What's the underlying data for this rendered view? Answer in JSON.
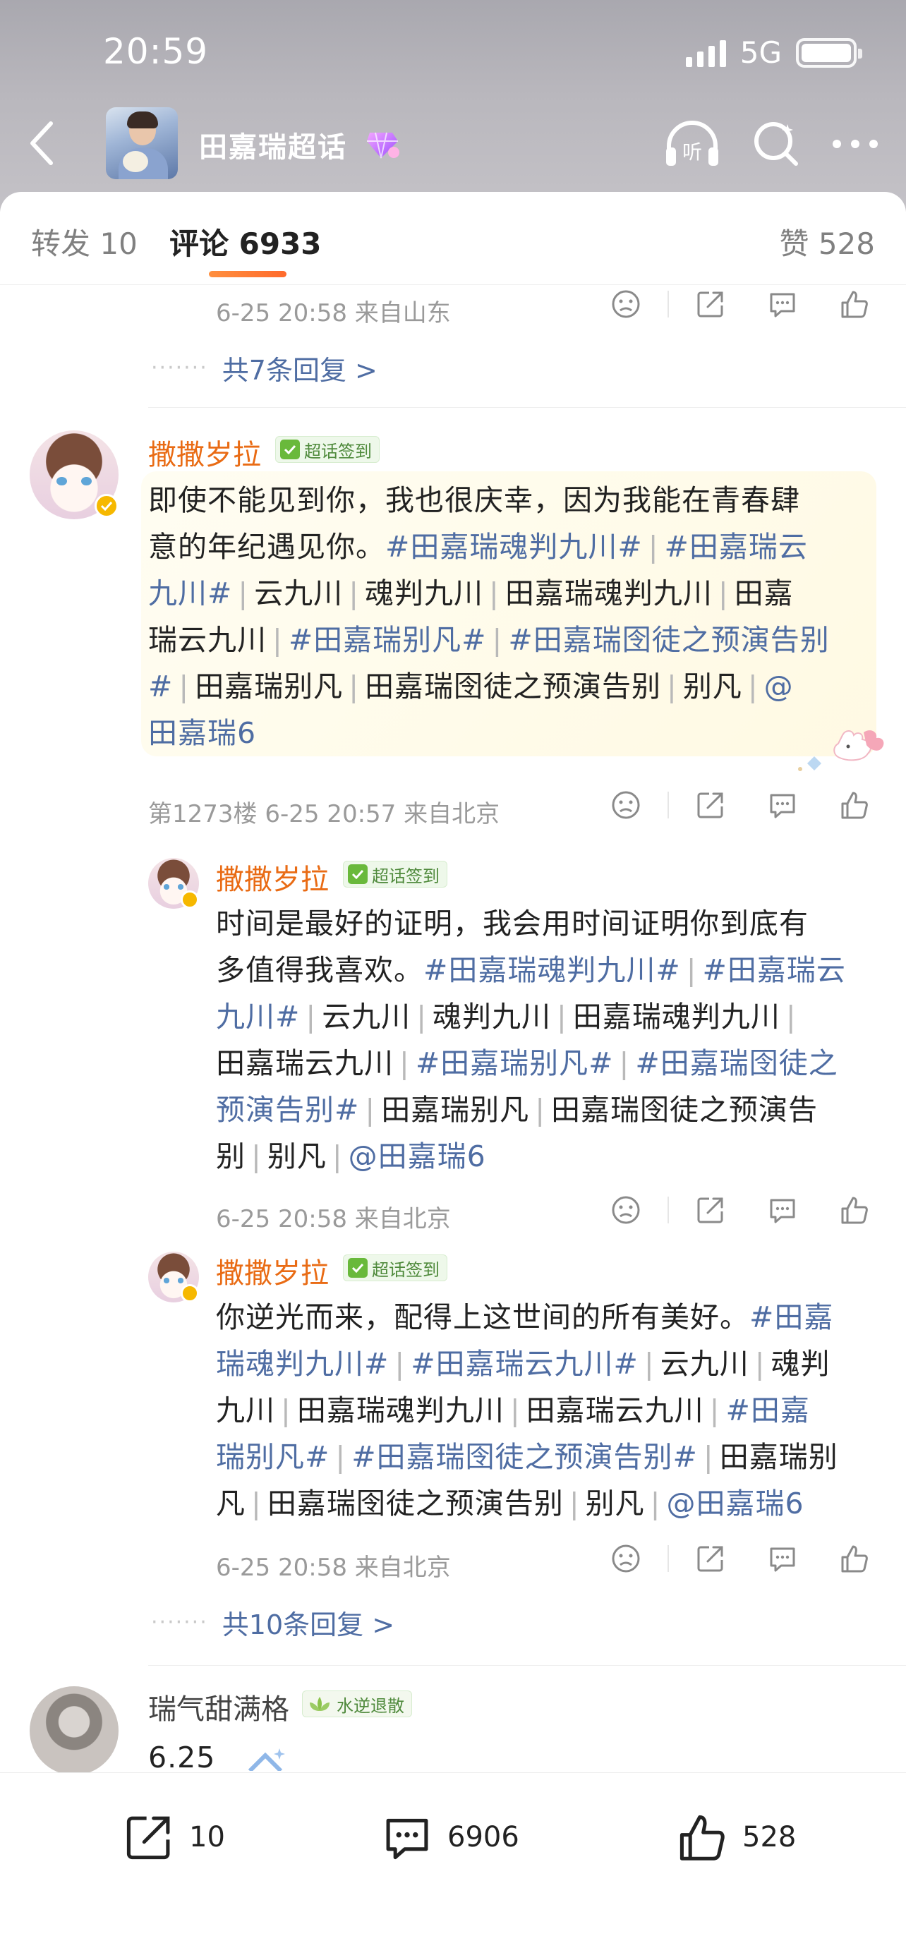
{
  "status": {
    "time": "20:59",
    "network": "5G"
  },
  "header": {
    "title": "田嘉瑞超话"
  },
  "tabs": {
    "repost": "转发 10",
    "comments": "评论 6933",
    "likes": "赞 528"
  },
  "top_partial": {
    "meta": "6-25 20:58  来自山东",
    "more_replies": "共7条回复 >"
  },
  "comment1": {
    "author": "撒撒岁拉",
    "badge": "超话签到",
    "lines": [
      [
        {
          "t": "即使不能见到你，我也很庆幸，因为我能在青春肆"
        }
      ],
      [
        {
          "t": "意的年纪遇见你。"
        },
        {
          "t": "#田嘉瑞魂判九川#",
          "link": true
        },
        {
          "t": "|",
          "sep": true
        },
        {
          "t": "#田嘉瑞云",
          "link": true
        }
      ],
      [
        {
          "t": "九川#",
          "link": true
        },
        {
          "t": "|",
          "sep": true
        },
        {
          "t": "云九川"
        },
        {
          "t": "|",
          "sep": true
        },
        {
          "t": "魂判九川"
        },
        {
          "t": "|",
          "sep": true
        },
        {
          "t": "田嘉瑞魂判九川"
        },
        {
          "t": "|",
          "sep": true
        },
        {
          "t": "田嘉"
        }
      ],
      [
        {
          "t": "瑞云九川"
        },
        {
          "t": "|",
          "sep": true
        },
        {
          "t": "#田嘉瑞别凡#",
          "link": true
        },
        {
          "t": "|",
          "sep": true
        },
        {
          "t": "#田嘉瑞囹徒之预演告别",
          "link": true
        }
      ],
      [
        {
          "t": "#",
          "link": true
        },
        {
          "t": "|",
          "sep": true
        },
        {
          "t": "田嘉瑞别凡"
        },
        {
          "t": "|",
          "sep": true
        },
        {
          "t": "田嘉瑞囹徒之预演告别"
        },
        {
          "t": "|",
          "sep": true
        },
        {
          "t": "别凡"
        },
        {
          "t": "|",
          "sep": true
        },
        {
          "t": "@",
          "link": true
        }
      ],
      [
        {
          "t": "田嘉瑞6",
          "link": true
        }
      ]
    ],
    "meta": "第1273楼  6-25 20:57  来自北京"
  },
  "reply1": {
    "author": "撒撒岁拉",
    "badge": "超话签到",
    "lines": [
      [
        {
          "t": "时间是最好的证明，我会用时间证明你到底有"
        }
      ],
      [
        {
          "t": "多值得我喜欢。"
        },
        {
          "t": "#田嘉瑞魂判九川#",
          "link": true
        },
        {
          "t": "|",
          "sep": true
        },
        {
          "t": "#田嘉瑞云",
          "link": true
        }
      ],
      [
        {
          "t": "九川#",
          "link": true
        },
        {
          "t": "|",
          "sep": true
        },
        {
          "t": "云九川"
        },
        {
          "t": "|",
          "sep": true
        },
        {
          "t": "魂判九川"
        },
        {
          "t": "|",
          "sep": true
        },
        {
          "t": "田嘉瑞魂判九川"
        },
        {
          "t": "|",
          "sep": true
        }
      ],
      [
        {
          "t": "田嘉瑞云九川"
        },
        {
          "t": "|",
          "sep": true
        },
        {
          "t": "#田嘉瑞别凡#",
          "link": true
        },
        {
          "t": "|",
          "sep": true
        },
        {
          "t": "#田嘉瑞囹徒之",
          "link": true
        }
      ],
      [
        {
          "t": "预演告别#",
          "link": true
        },
        {
          "t": "|",
          "sep": true
        },
        {
          "t": "田嘉瑞别凡"
        },
        {
          "t": "|",
          "sep": true
        },
        {
          "t": "田嘉瑞囹徒之预演告"
        }
      ],
      [
        {
          "t": "别"
        },
        {
          "t": "|",
          "sep": true
        },
        {
          "t": "别凡"
        },
        {
          "t": "|",
          "sep": true
        },
        {
          "t": "@田嘉瑞6",
          "link": true
        }
      ]
    ],
    "meta": "6-25 20:58  来自北京"
  },
  "reply2": {
    "author": "撒撒岁拉",
    "badge": "超话签到",
    "lines": [
      [
        {
          "t": "你逆光而来，配得上这世间的所有美好。"
        },
        {
          "t": "#田嘉",
          "link": true
        }
      ],
      [
        {
          "t": "瑞魂判九川#",
          "link": true
        },
        {
          "t": "|",
          "sep": true
        },
        {
          "t": "#田嘉瑞云九川#",
          "link": true
        },
        {
          "t": "|",
          "sep": true
        },
        {
          "t": "云九川"
        },
        {
          "t": "|",
          "sep": true
        },
        {
          "t": "魂判"
        }
      ],
      [
        {
          "t": "九川"
        },
        {
          "t": "|",
          "sep": true
        },
        {
          "t": "田嘉瑞魂判九川"
        },
        {
          "t": "|",
          "sep": true
        },
        {
          "t": "田嘉瑞云九川"
        },
        {
          "t": "|",
          "sep": true
        },
        {
          "t": "#田嘉",
          "link": true
        }
      ],
      [
        {
          "t": "瑞别凡#",
          "link": true
        },
        {
          "t": "|",
          "sep": true
        },
        {
          "t": "#田嘉瑞囹徒之预演告别#",
          "link": true
        },
        {
          "t": "|",
          "sep": true
        },
        {
          "t": "田嘉瑞别"
        }
      ],
      [
        {
          "t": "凡"
        },
        {
          "t": "|",
          "sep": true
        },
        {
          "t": "田嘉瑞囹徒之预演告别"
        },
        {
          "t": "|",
          "sep": true
        },
        {
          "t": "别凡"
        },
        {
          "t": "|",
          "sep": true
        },
        {
          "t": "@田嘉瑞6",
          "link": true
        }
      ]
    ],
    "meta": "6-25 20:58  来自北京"
  },
  "replies_more": "共10条回复 >",
  "comment2": {
    "author": "瑞气甜满格",
    "badge": "水逆退散",
    "text": "6.25"
  },
  "bottom_bar": {
    "repost_count": "10",
    "comment_count": "6906",
    "like_count": "528"
  },
  "colors": {
    "accent": "#ff7a2f",
    "link": "#4f6da3",
    "author": "#e96b14"
  }
}
